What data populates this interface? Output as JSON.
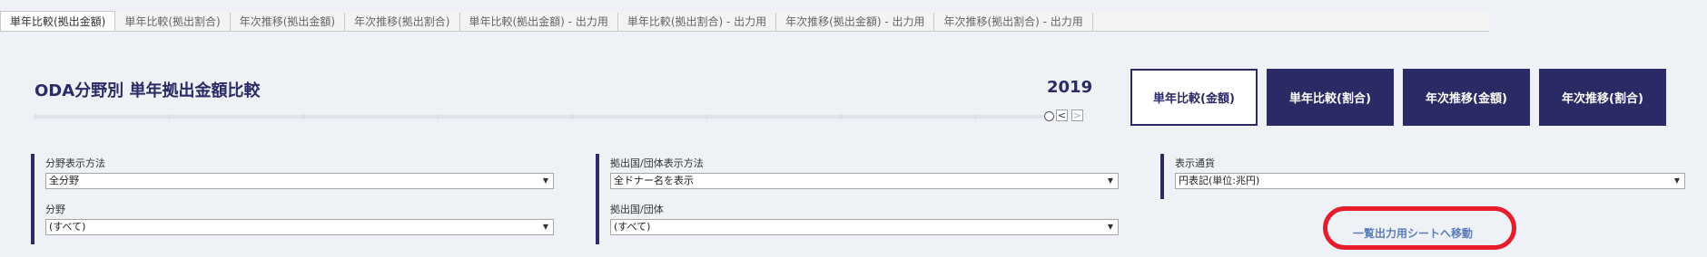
{
  "tabs": [
    {
      "label": "単年比較(拠出金額)",
      "active": true
    },
    {
      "label": "単年比較(拠出割合)",
      "active": false
    },
    {
      "label": "年次推移(拠出金額)",
      "active": false
    },
    {
      "label": "年次推移(拠出割合)",
      "active": false
    },
    {
      "label": "単年比較(拠出金額) - 出力用",
      "active": false
    },
    {
      "label": "単年比較(拠出割合) - 出力用",
      "active": false
    },
    {
      "label": "年次推移(拠出金額) - 出力用",
      "active": false
    },
    {
      "label": "年次推移(拠出割合) - 出力用",
      "active": false
    }
  ],
  "header": {
    "title": "ODA分野別 単年拠出金額比較",
    "year": "2019",
    "prev_symbol": "<",
    "next_symbol": ">"
  },
  "view_buttons": [
    {
      "label": "単年比較(金額)",
      "selected": true
    },
    {
      "label": "単年比較(割合)",
      "selected": false
    },
    {
      "label": "年次推移(金額)",
      "selected": false
    },
    {
      "label": "年次推移(割合)",
      "selected": false
    }
  ],
  "filters": {
    "sector_display": {
      "label": "分野表示方法",
      "value": "全分野"
    },
    "sector": {
      "label": "分野",
      "value": "(すべて)"
    },
    "donor_display": {
      "label": "拠出国/団体表示方法",
      "value": "全ドナー名を表示"
    },
    "donor": {
      "label": "拠出国/団体",
      "value": "(すべて)"
    },
    "currency": {
      "label": "表示通貨",
      "value": "円表記(単位:兆円)"
    }
  },
  "nav_link": {
    "label": "一覧出力用シートへ移動"
  },
  "icons": {
    "dropdown": "chevron-down-icon",
    "highlight": "red-oval-annotation"
  },
  "colors": {
    "navy": "#2a2a64",
    "link": "#5a7db8",
    "annotation": "#e81d2c"
  }
}
